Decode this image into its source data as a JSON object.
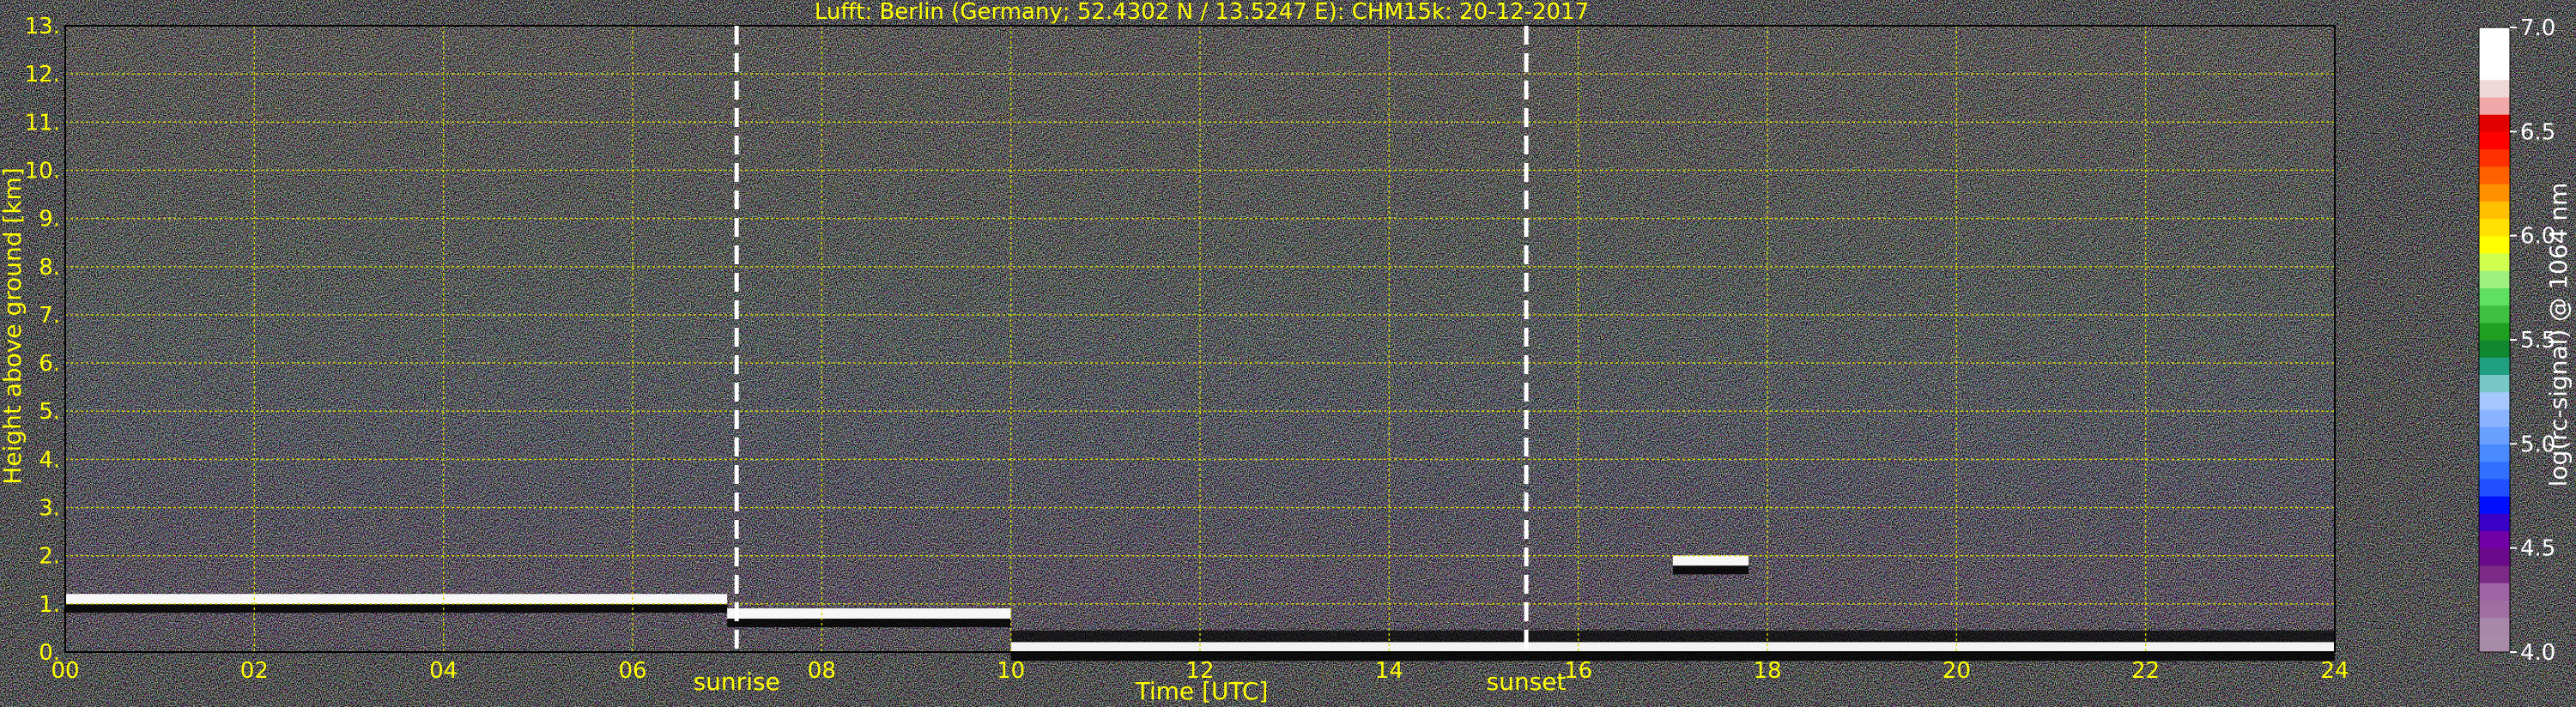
{
  "colors": {
    "background": "#000000",
    "text_yellow": "#ffff00",
    "text_white": "#ffffff",
    "grid": "#d8d800"
  },
  "chart_data": {
    "type": "heatmap",
    "title": "Lufft: Berlin (Germany; 52.4302 N / 13.5247 E):    CHM15k: 20-12-2017",
    "xlabel": "Time [UTC]",
    "ylabel": "Height above ground [km]",
    "xlim": [
      0,
      24
    ],
    "ylim": [
      0,
      13
    ],
    "xticks": [
      "00",
      "02",
      "04",
      "06",
      "08",
      "10",
      "12",
      "14",
      "16",
      "18",
      "20",
      "22",
      "24"
    ],
    "yticks": [
      "0.",
      "1.",
      "2.",
      "3.",
      "4.",
      "5.",
      "6.",
      "7.",
      "8.",
      "9.",
      "10.",
      "11.",
      "12.",
      "13."
    ],
    "grid": true,
    "events": [
      {
        "label": "sunrise",
        "time": 7.1
      },
      {
        "label": "sunset",
        "time": 15.45
      }
    ],
    "colorbar": {
      "label": "log(rc-signal) @ 1064 nm",
      "range": [
        4.0,
        7.0
      ],
      "ticks": [
        "4.0",
        "4.5",
        "5.0",
        "5.5",
        "6.0",
        "6.5",
        "7.0"
      ],
      "colors": [
        "#a88ba8",
        "#a888a8",
        "#9e6fa0",
        "#a064a6",
        "#7b2b86",
        "#6a0a8a",
        "#7000a6",
        "#3a00c8",
        "#0010ff",
        "#2050ff",
        "#3070ff",
        "#4a8aff",
        "#6aa0ff",
        "#8ab4ff",
        "#a6c8ff",
        "#78c8c8",
        "#20a080",
        "#108830",
        "#20a020",
        "#40c040",
        "#60e060",
        "#a0f080",
        "#d0ff50",
        "#ffff00",
        "#ffe000",
        "#ffc000",
        "#ff9000",
        "#ff6000",
        "#ff3000",
        "#ff0000",
        "#e00000",
        "#f0a8a8",
        "#f0d8d8",
        "#ffffff",
        "#ffffff",
        "#ffffff"
      ]
    },
    "cloud_base_layers": [
      {
        "t_start": 0.0,
        "t_end": 7.0,
        "height": 1.1
      },
      {
        "t_start": 7.0,
        "t_end": 10.0,
        "height": 0.8
      },
      {
        "t_start": 10.0,
        "t_end": 24.0,
        "height": 0.1
      },
      {
        "t_start": 17.0,
        "t_end": 17.8,
        "height": 1.9
      }
    ]
  }
}
